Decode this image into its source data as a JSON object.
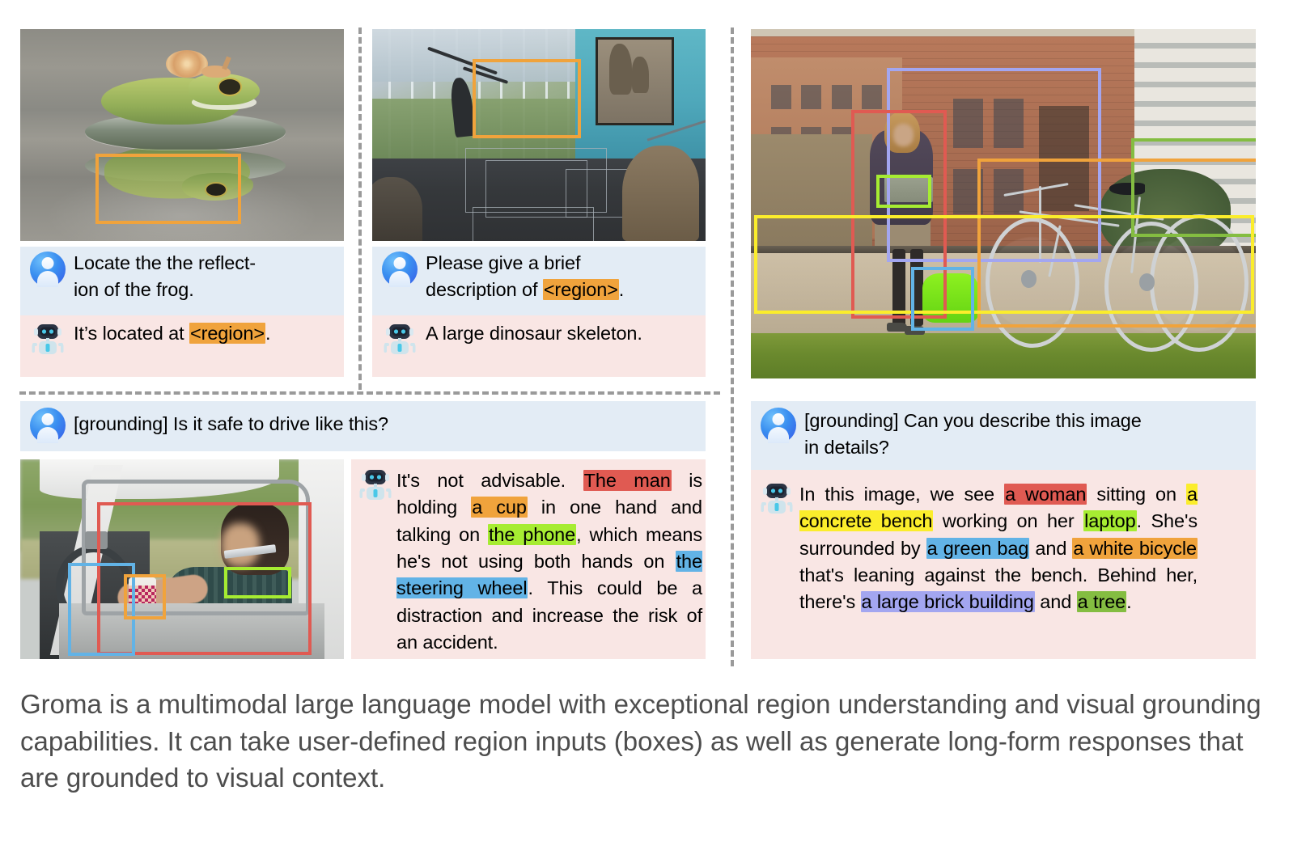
{
  "figure": {
    "caption": "Groma is a multimodal large language model with exceptional region understanding and visual grounding capabilities. It can take user-defined region inputs (boxes) as well as generate long-form responses that are grounded to visual context."
  },
  "icons": {
    "user_avatar": "user-avatar-icon",
    "bot_avatar": "robot-avatar-icon"
  },
  "colors": {
    "user_bubble_bg": "#e3ecf5",
    "bot_bubble_bg": "#f9e6e4",
    "divider": "#9a9a9a",
    "highlight_red": "#e05a52",
    "highlight_orange": "#f0a33c",
    "highlight_green": "#a6ec32",
    "highlight_blue": "#62b3e6",
    "highlight_yellow": "#fbed2c",
    "highlight_purple": "#a3a6f0",
    "highlight_olive": "#84bd41",
    "caption_text": "#4d4d4d"
  },
  "examples": {
    "frog": {
      "image_alt": "A green tree frog with a snail on its back sitting on a turtle in water, with its reflection below",
      "boxes": [
        {
          "color": "#f0a33c",
          "label": "reflection-of-the-frog"
        }
      ],
      "turns": [
        {
          "role": "user",
          "line1": "Locate the the reflect-",
          "line2": "ion of the frog."
        },
        {
          "role": "bot",
          "prefix": "It’s located at ",
          "region": "<region>",
          "suffix": "."
        }
      ]
    },
    "dinosaur": {
      "image_alt": "Museum hall with glass wall and a dinosaur skeleton on display",
      "boxes": [
        {
          "color": "#f0a33c",
          "label": "dinosaur-skeleton"
        }
      ],
      "turns": [
        {
          "role": "user",
          "line1": "Please give a brief",
          "line2_prefix": "description of ",
          "region": "<region>",
          "line2_suffix": "."
        },
        {
          "role": "bot",
          "text": "A large dinosaur skeleton."
        }
      ]
    },
    "bicycle_woman": {
      "image_alt": "Woman sitting on a concrete bench with a laptop, a green bag beside her and a white bicycle leaning against the bench, brick building and tree behind",
      "boxes": [
        {
          "color": "#a3a6f0",
          "label": "a-large-brick-building"
        },
        {
          "color": "#e05a52",
          "label": "a-woman"
        },
        {
          "color": "#a6ec32",
          "label": "laptop"
        },
        {
          "color": "#f0a33c",
          "label": "a-white-bicycle"
        },
        {
          "color": "#fbed2c",
          "label": "a-concrete-bench"
        },
        {
          "color": "#62b3e6",
          "label": "a-green-bag"
        },
        {
          "color": "#84bd41",
          "label": "a-tree"
        }
      ]
    },
    "car": {
      "image_alt": "Man driving a car holding a paper cup in one hand and a phone to his ear",
      "boxes": [
        {
          "color": "#e05a52",
          "label": "the-man"
        },
        {
          "color": "#f0a33c",
          "label": "a-cup"
        },
        {
          "color": "#a6ec32",
          "label": "the-phone"
        },
        {
          "color": "#62b3e6",
          "label": "the-steering-wheel"
        }
      ]
    }
  },
  "dialogs": {
    "driving": {
      "question": "[grounding] Is it safe to drive like this?",
      "answer_parts": [
        {
          "text": "It's not advisable. ",
          "highlight": null
        },
        {
          "text": "The man",
          "highlight": "red"
        },
        {
          "text": " is holding ",
          "highlight": null
        },
        {
          "text": "a cup",
          "highlight": "orange"
        },
        {
          "text": " in one hand and talking on ",
          "highlight": null
        },
        {
          "text": "the phone",
          "highlight": "green"
        },
        {
          "text": ", which means he's not using both hands on ",
          "highlight": null
        },
        {
          "text": "the steering wheel",
          "highlight": "blue"
        },
        {
          "text": ". This could be a distraction and increase the risk of an accident.",
          "highlight": null
        }
      ]
    },
    "describe": {
      "question_line1": "[grounding] Can you describe this image",
      "question_line2": "in details?",
      "answer_parts": [
        {
          "text": "In this image, we see ",
          "highlight": null
        },
        {
          "text": "a woman",
          "highlight": "red"
        },
        {
          "text": " sitting on ",
          "highlight": null
        },
        {
          "text": "a concrete bench",
          "highlight": "yellow"
        },
        {
          "text": " working on her ",
          "highlight": null
        },
        {
          "text": "laptop",
          "highlight": "green"
        },
        {
          "text": ". She's surrounded by ",
          "highlight": null
        },
        {
          "text": "a green bag",
          "highlight": "blue"
        },
        {
          "text": " and ",
          "highlight": null
        },
        {
          "text": "a white bicycle",
          "highlight": "orange"
        },
        {
          "text": " that's leaning against the bench. Behind her, there's ",
          "highlight": null
        },
        {
          "text": "a large brick building",
          "highlight": "purple"
        },
        {
          "text": " and ",
          "highlight": null
        },
        {
          "text": "a tree",
          "highlight": "olive"
        },
        {
          "text": ".",
          "highlight": null
        }
      ]
    }
  }
}
